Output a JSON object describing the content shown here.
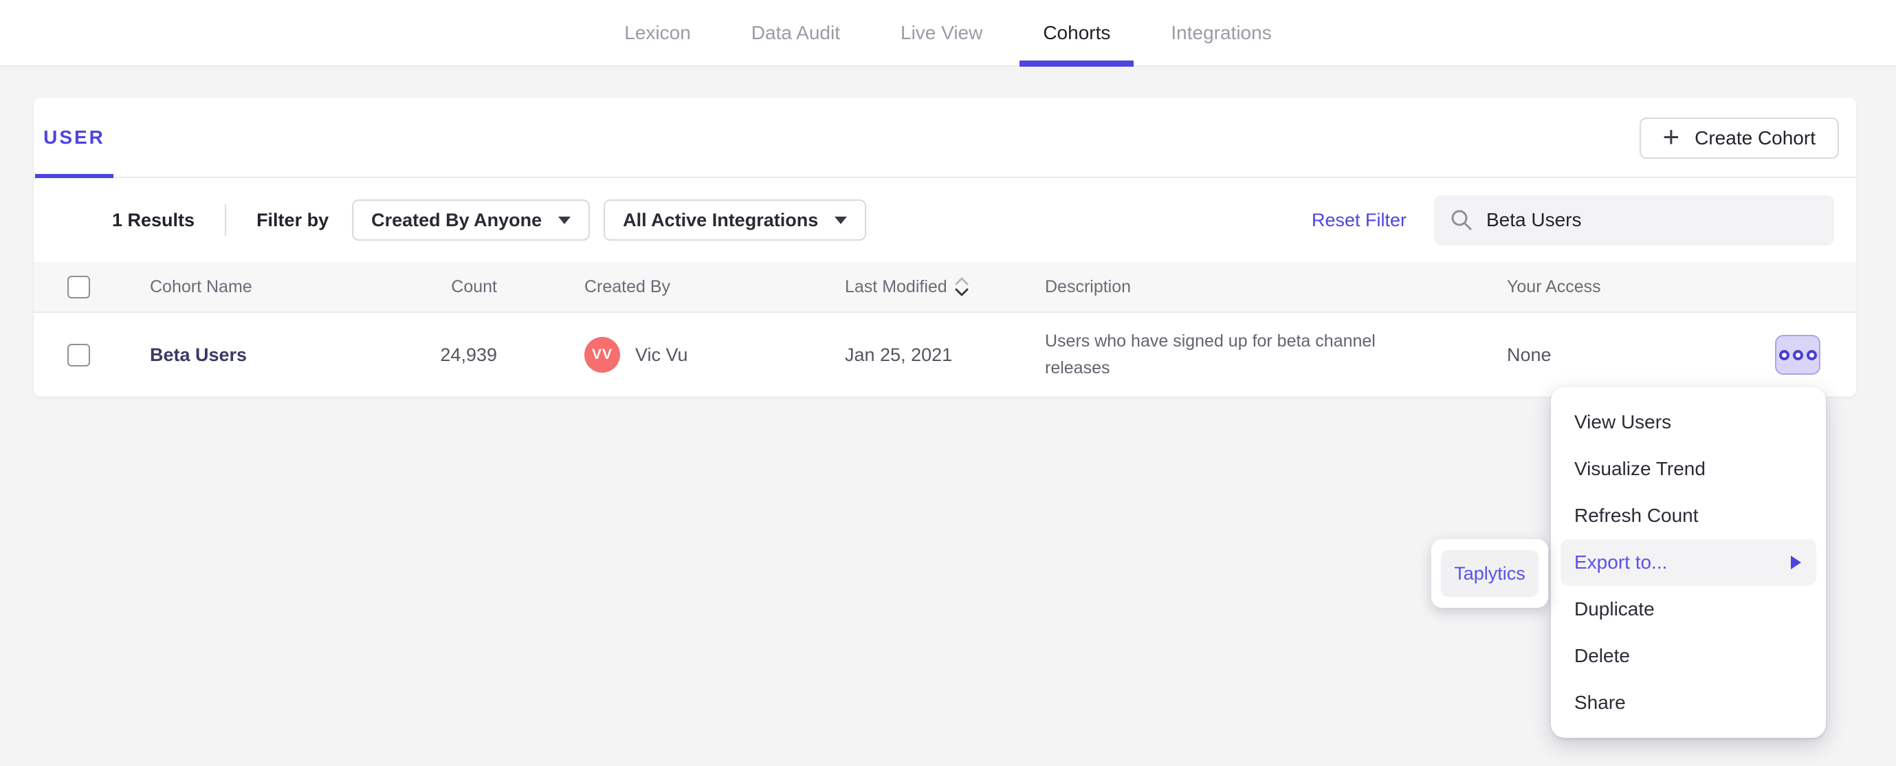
{
  "colors": {
    "accent_purple": "#4f44e0",
    "menu_purple": "#5b51e8",
    "avatar_coral": "#f66e6e",
    "page_bg": "#f4f4f5"
  },
  "nav": {
    "tabs": [
      {
        "label": "Lexicon",
        "active": false
      },
      {
        "label": "Data Audit",
        "active": false
      },
      {
        "label": "Live View",
        "active": false
      },
      {
        "label": "Cohorts",
        "active": true
      },
      {
        "label": "Integrations",
        "active": false
      }
    ]
  },
  "cohorts_panel": {
    "user_tab_label": "USER",
    "create_button": {
      "plus": "+",
      "label": "Create Cohort"
    },
    "filter_bar": {
      "results_count": "1 Results",
      "filter_by_label": "Filter by",
      "created_by_dropdown": "Created By Anyone",
      "integrations_dropdown": "All Active Integrations",
      "reset_filter_label": "Reset Filter",
      "search_value": "Beta Users"
    },
    "table": {
      "headers": {
        "name": "Cohort Name",
        "count": "Count",
        "created_by": "Created By",
        "last_modified": "Last Modified",
        "description": "Description",
        "access": "Your Access"
      },
      "rows": [
        {
          "name": "Beta Users",
          "count": "24,939",
          "creator_initials": "VV",
          "creator_name": "Vic Vu",
          "last_modified": "Jan 25, 2021",
          "description": "Users who have signed up for beta channel releases",
          "access": "None"
        }
      ]
    }
  },
  "context_menu": {
    "items": [
      {
        "label": "View Users"
      },
      {
        "label": "Visualize Trend"
      },
      {
        "label": "Refresh Count"
      },
      {
        "label": "Export to...",
        "highlighted": true,
        "has_submenu": true
      },
      {
        "label": "Duplicate"
      },
      {
        "label": "Delete"
      },
      {
        "label": "Share"
      }
    ],
    "submenu": {
      "items": [
        {
          "label": "Taplytics"
        }
      ]
    }
  }
}
